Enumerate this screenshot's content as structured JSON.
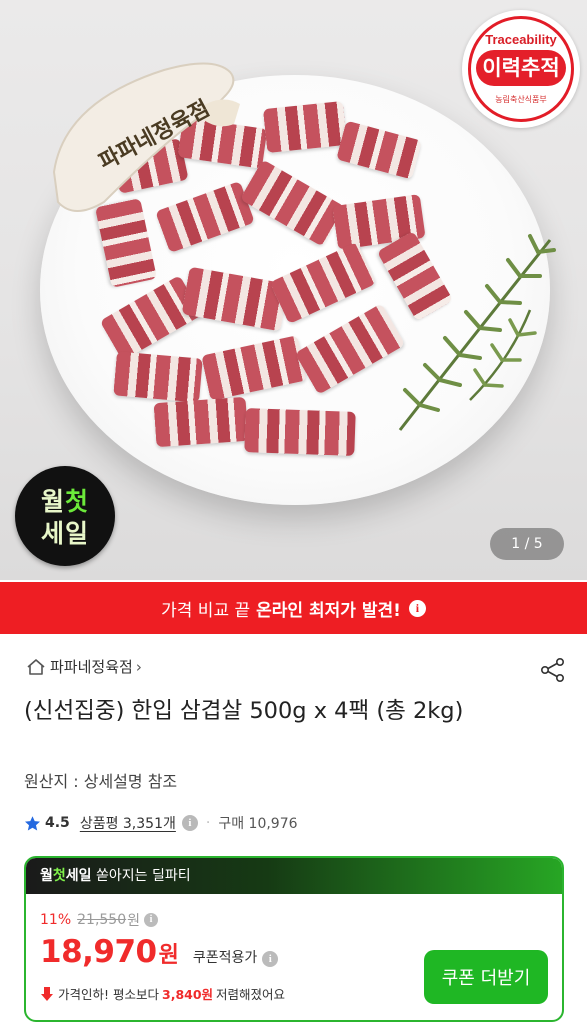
{
  "hero": {
    "brand_logo_text": "파파네정육점",
    "traceability": {
      "en": "Traceability",
      "ko": "이력추적",
      "org": "농림축산식품부"
    },
    "sale_badge": {
      "line1_a": "월",
      "line1_b": "첫",
      "line2": "세일"
    },
    "pager": "1 / 5"
  },
  "banner": {
    "pre": "가격 비교 끝",
    "strong": "온라인 최저가 발견!",
    "info": "i"
  },
  "product": {
    "store_name": "파파네정육점",
    "store_chevron": "›",
    "title": "(신선집중) 한입 삼겹살 500g x 4팩 (총 2kg)",
    "origin": "원산지 : 상세설명 참조",
    "rating": "4.5",
    "reviews": "상품평 3,351개",
    "separator": "·",
    "purchases": "구매 10,976"
  },
  "deal": {
    "header_b1": "월",
    "header_b2": "첫",
    "header_b3": "세일",
    "header_rest": "쏟아지는 딜파티",
    "discount_pct": "11%",
    "original_price": "21,550",
    "won": "원",
    "price": "18,970",
    "coupon_note": "쿠폰적용가",
    "drop_pre": "가격인하! 평소보다",
    "drop_amount": "3,840원",
    "drop_post": "저렴해졌어요",
    "coupon_button": "쿠폰 더받기"
  },
  "colors": {
    "accent_red": "#ee1e23",
    "price_red": "#f02b2b",
    "deal_green": "#1fb724",
    "star_blue": "#2469e0"
  }
}
